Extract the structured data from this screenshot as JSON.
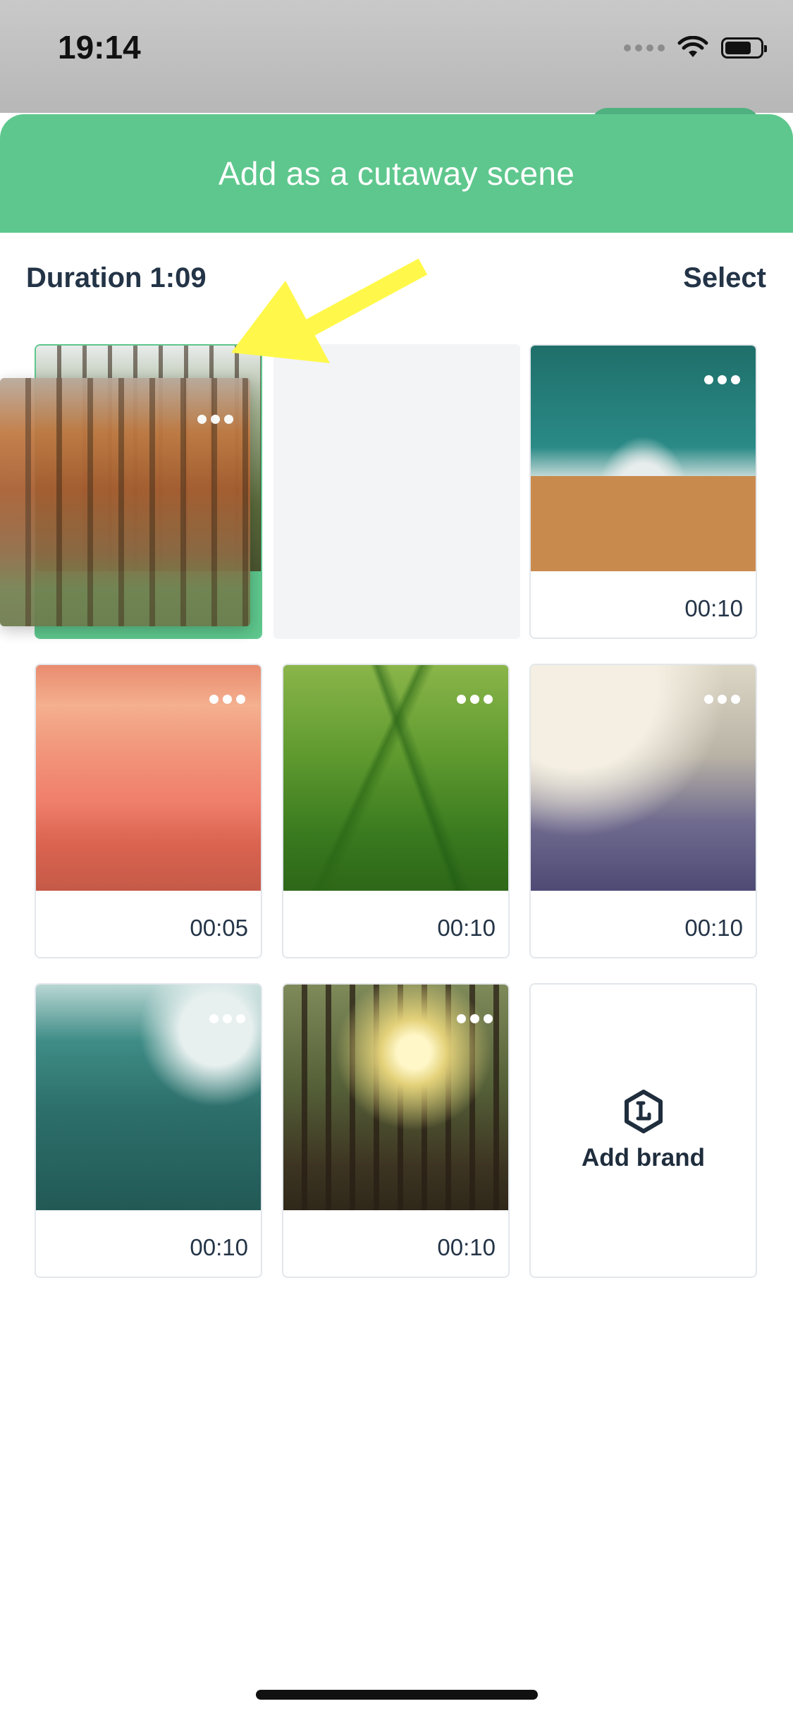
{
  "status_bar": {
    "time": "19:14"
  },
  "header": {
    "title": "Add as a cutaway scene"
  },
  "toolbar": {
    "duration": "Duration 1:09",
    "select": "Select"
  },
  "tiles": [
    {
      "duration": "00:10"
    },
    {
      "duration": "00:05"
    },
    {
      "duration": "00:10"
    },
    {
      "duration": "00:10"
    },
    {
      "duration": "00:10"
    },
    {
      "duration": "00:10"
    }
  ],
  "add_brand": {
    "label": "Add brand",
    "icon": "brand-hexagon-icon"
  },
  "colors": {
    "accent": "#5ec78d",
    "text": "#243447"
  }
}
